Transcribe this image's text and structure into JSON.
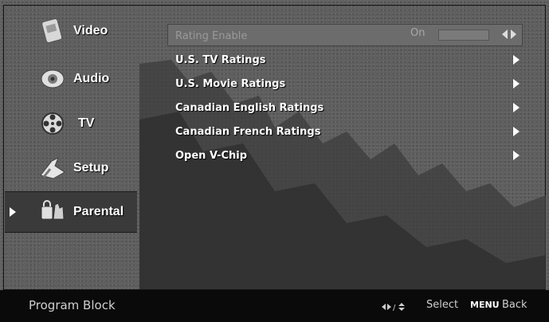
{
  "sidebar": {
    "items": [
      {
        "label": "Video",
        "icon": "video-icon"
      },
      {
        "label": "Audio",
        "icon": "audio-icon"
      },
      {
        "label": "TV",
        "icon": "tv-reel-icon"
      },
      {
        "label": "Setup",
        "icon": "setup-icon"
      },
      {
        "label": "Parental",
        "icon": "parental-icon",
        "active": true
      }
    ]
  },
  "menu": {
    "rating_enable": {
      "label": "Rating Enable",
      "value": "On"
    },
    "items": [
      {
        "label": "U.S. TV Ratings"
      },
      {
        "label": "U.S. Movie Ratings"
      },
      {
        "label": "Canadian English Ratings"
      },
      {
        "label": "Canadian French Ratings"
      },
      {
        "label": "Open V-Chip"
      }
    ]
  },
  "footer": {
    "title": "Program Block",
    "select_label": "Select",
    "menu_key": "MENU",
    "back_label": "Back"
  },
  "colors": {
    "background": "#5f5f5f",
    "footer": "#0a0a0a",
    "text": "#ffffff",
    "dim_text": "#9a9a9a"
  }
}
